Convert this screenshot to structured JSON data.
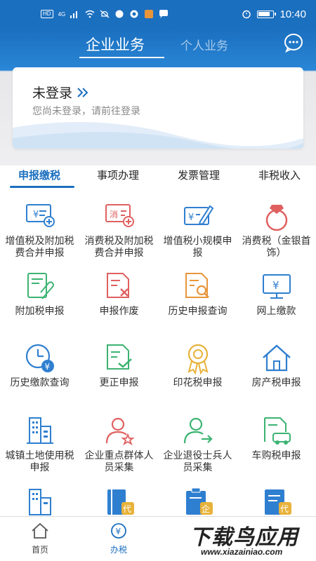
{
  "status_bar": {
    "time": "10:40",
    "network_badge": "HD",
    "signal_label": "4G"
  },
  "header": {
    "tabs": [
      {
        "label": "企业业务",
        "active": true
      },
      {
        "label": "个人业务",
        "active": false
      }
    ],
    "chat_icon": "chat-bubble-icon"
  },
  "login_card": {
    "title": "未登录",
    "subtitle": "您尚未登录，请前往登录"
  },
  "section_tabs": [
    {
      "label": "申报缴税",
      "active": true
    },
    {
      "label": "事项办理",
      "active": false
    },
    {
      "label": "发票管理",
      "active": false
    },
    {
      "label": "非税收入",
      "active": false
    }
  ],
  "grid_items": [
    {
      "label": "增值税及附加税费合并申报",
      "icon": "vat-form-icon"
    },
    {
      "label": "消费税及附加税费合并申报",
      "icon": "consumption-form-icon",
      "icon_text": "消"
    },
    {
      "label": "增值税小规模申报",
      "icon": "small-scale-form-icon"
    },
    {
      "label": "消费税（金银首饰）",
      "icon": "jewelry-ring-icon"
    },
    {
      "label": "附加税申报",
      "icon": "attachment-doc-icon"
    },
    {
      "label": "申报作废",
      "icon": "void-doc-icon"
    },
    {
      "label": "历史申报查询",
      "icon": "search-doc-icon"
    },
    {
      "label": "网上缴款",
      "icon": "monitor-yuan-icon"
    },
    {
      "label": "历史缴款查询",
      "icon": "clock-yuan-icon"
    },
    {
      "label": "更正申报",
      "icon": "correct-doc-icon"
    },
    {
      "label": "印花税申报",
      "icon": "award-ribbon-icon"
    },
    {
      "label": "房产税申报",
      "icon": "house-icon"
    },
    {
      "label": "城镇土地使用税申报",
      "icon": "buildings-icon"
    },
    {
      "label": "企业重点群体人员采集",
      "icon": "person-star-icon"
    },
    {
      "label": "企业退役士兵人员采集",
      "icon": "person-arrow-icon"
    },
    {
      "label": "车购税申报",
      "icon": "car-doc-icon"
    },
    {
      "label": "",
      "icon": "buildings-icon"
    },
    {
      "label": "",
      "icon": "book-dai-icon",
      "icon_text": "代"
    },
    {
      "label": "",
      "icon": "clipboard-qi-icon",
      "icon_text": "企"
    },
    {
      "label": "",
      "icon": "doc-dai-icon",
      "icon_text": "代"
    }
  ],
  "bottom_nav": [
    {
      "label": "首页",
      "icon": "home-icon",
      "active": false
    },
    {
      "label": "办税",
      "icon": "tax-yuan-icon",
      "active": true
    }
  ],
  "watermark": {
    "big": "下载鸟应用",
    "small": "www.xiazainiao.com"
  },
  "colors": {
    "brand_blue": "#1b6fbf",
    "accent_green": "#3cb371",
    "accent_red": "#e06060",
    "accent_orange": "#e8953a"
  }
}
